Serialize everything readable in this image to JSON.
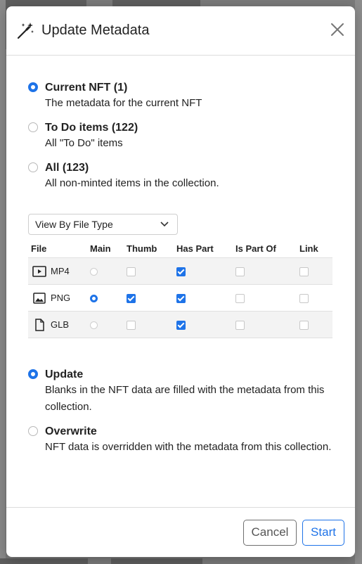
{
  "dialog": {
    "title": "Update Metadata",
    "icon": "magic-wand-icon"
  },
  "scope_options": [
    {
      "title": "Current NFT (1)",
      "desc": "The metadata for the current NFT",
      "selected": true
    },
    {
      "title": "To Do items (122)",
      "desc": "All \"To Do\" items",
      "selected": false
    },
    {
      "title": "All (123)",
      "desc": "All non-minted items in the collection.",
      "selected": false
    }
  ],
  "view_select": {
    "value": "View By File Type"
  },
  "file_table": {
    "headers": [
      "File",
      "Main",
      "Thumb",
      "Has Part",
      "Is Part Of",
      "Link"
    ],
    "rows": [
      {
        "file": "MP4",
        "icon": "video-play-icon",
        "main": false,
        "thumb": false,
        "has_part": true,
        "is_part_of": false,
        "link": false
      },
      {
        "file": "PNG",
        "icon": "image-icon",
        "main": true,
        "thumb": true,
        "has_part": true,
        "is_part_of": false,
        "link": false
      },
      {
        "file": "GLB",
        "icon": "document-icon",
        "main": false,
        "thumb": false,
        "has_part": true,
        "is_part_of": false,
        "link": false
      }
    ]
  },
  "mode_options": [
    {
      "title": "Update",
      "desc": "Blanks in the NFT data are filled with the metadata from this collection.",
      "selected": true
    },
    {
      "title": "Overwrite",
      "desc": "NFT data is overridden with the metadata from this collection.",
      "selected": false
    }
  ],
  "footer": {
    "cancel_label": "Cancel",
    "start_label": "Start"
  },
  "colors": {
    "accent": "#1e73e8"
  }
}
